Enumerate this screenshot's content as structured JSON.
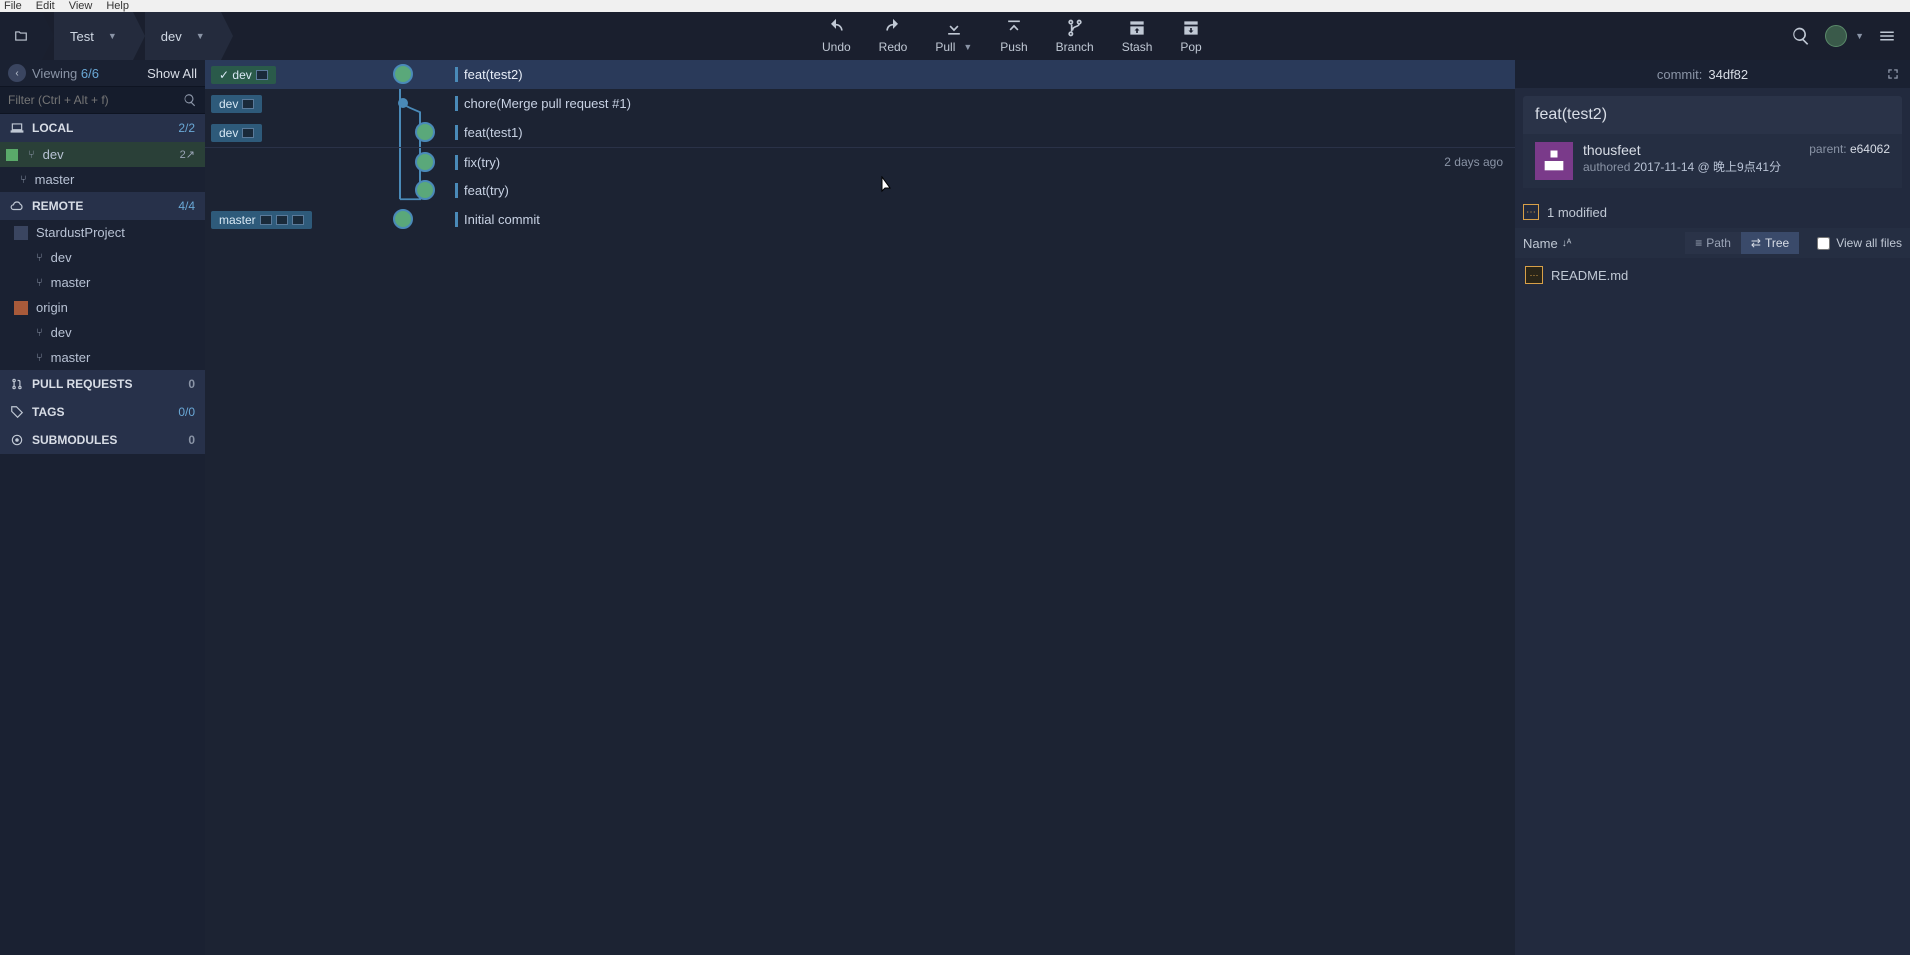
{
  "menubar": [
    "File",
    "Edit",
    "View",
    "Help"
  ],
  "breadcrumb": {
    "repo": "Test",
    "branch": "dev"
  },
  "toolbar": {
    "undo": "Undo",
    "redo": "Redo",
    "pull": "Pull",
    "push": "Push",
    "branch": "Branch",
    "stash": "Stash",
    "pop": "Pop"
  },
  "left": {
    "viewing_label": "Viewing",
    "viewing_count": "6/6",
    "show_all": "Show All",
    "filter_placeholder": "Filter (Ctrl + Alt + f)",
    "sections": {
      "local": {
        "title": "LOCAL",
        "count": "2/2"
      },
      "remote": {
        "title": "REMOTE",
        "count": "4/4"
      },
      "pull_requests": {
        "title": "PULL REQUESTS",
        "count": "0"
      },
      "tags": {
        "title": "TAGS",
        "count": "0/0"
      },
      "submodules": {
        "title": "SUBMODULES",
        "count": "0"
      }
    },
    "local_branches": [
      {
        "name": "dev",
        "ahead": "2↗",
        "active": true
      },
      {
        "name": "master"
      }
    ],
    "remotes": [
      {
        "name": "StardustProject",
        "branches": [
          "dev",
          "master"
        ]
      },
      {
        "name": "origin",
        "branches": [
          "dev",
          "master"
        ]
      }
    ]
  },
  "commits": [
    {
      "refs": [
        {
          "text": "✓ dev",
          "class": "green",
          "icons": [
            "laptop"
          ]
        }
      ],
      "msg": "feat(test2)",
      "selected": true
    },
    {
      "refs": [
        {
          "text": "dev",
          "icons": [
            "monitor"
          ]
        }
      ],
      "msg": "chore(Merge pull request #1)"
    },
    {
      "refs": [
        {
          "text": "dev",
          "icons": [
            "gitlab"
          ]
        }
      ],
      "msg": "feat(test1)"
    },
    {
      "refs": [],
      "msg": "fix(try)",
      "time": "2 days ago",
      "sep": true
    },
    {
      "refs": [],
      "msg": "feat(try)"
    },
    {
      "refs": [
        {
          "text": "master",
          "icons": [
            "monitor",
            "gitlab",
            "laptop"
          ]
        }
      ],
      "msg": "Initial commit"
    }
  ],
  "detail": {
    "commit_label": "commit:",
    "commit_hash": "34df82",
    "title": "feat(test2)",
    "author": "thousfeet",
    "authored_label": "authored",
    "date": "2017-11-14 @ 晚上9点41分",
    "parent_label": "parent:",
    "parent_hash": "e64062",
    "modified_count": "1 modified",
    "name_sort": "Name",
    "path_btn": "Path",
    "tree_btn": "Tree",
    "view_all": "View all files",
    "files": [
      {
        "name": "README.md"
      }
    ]
  }
}
